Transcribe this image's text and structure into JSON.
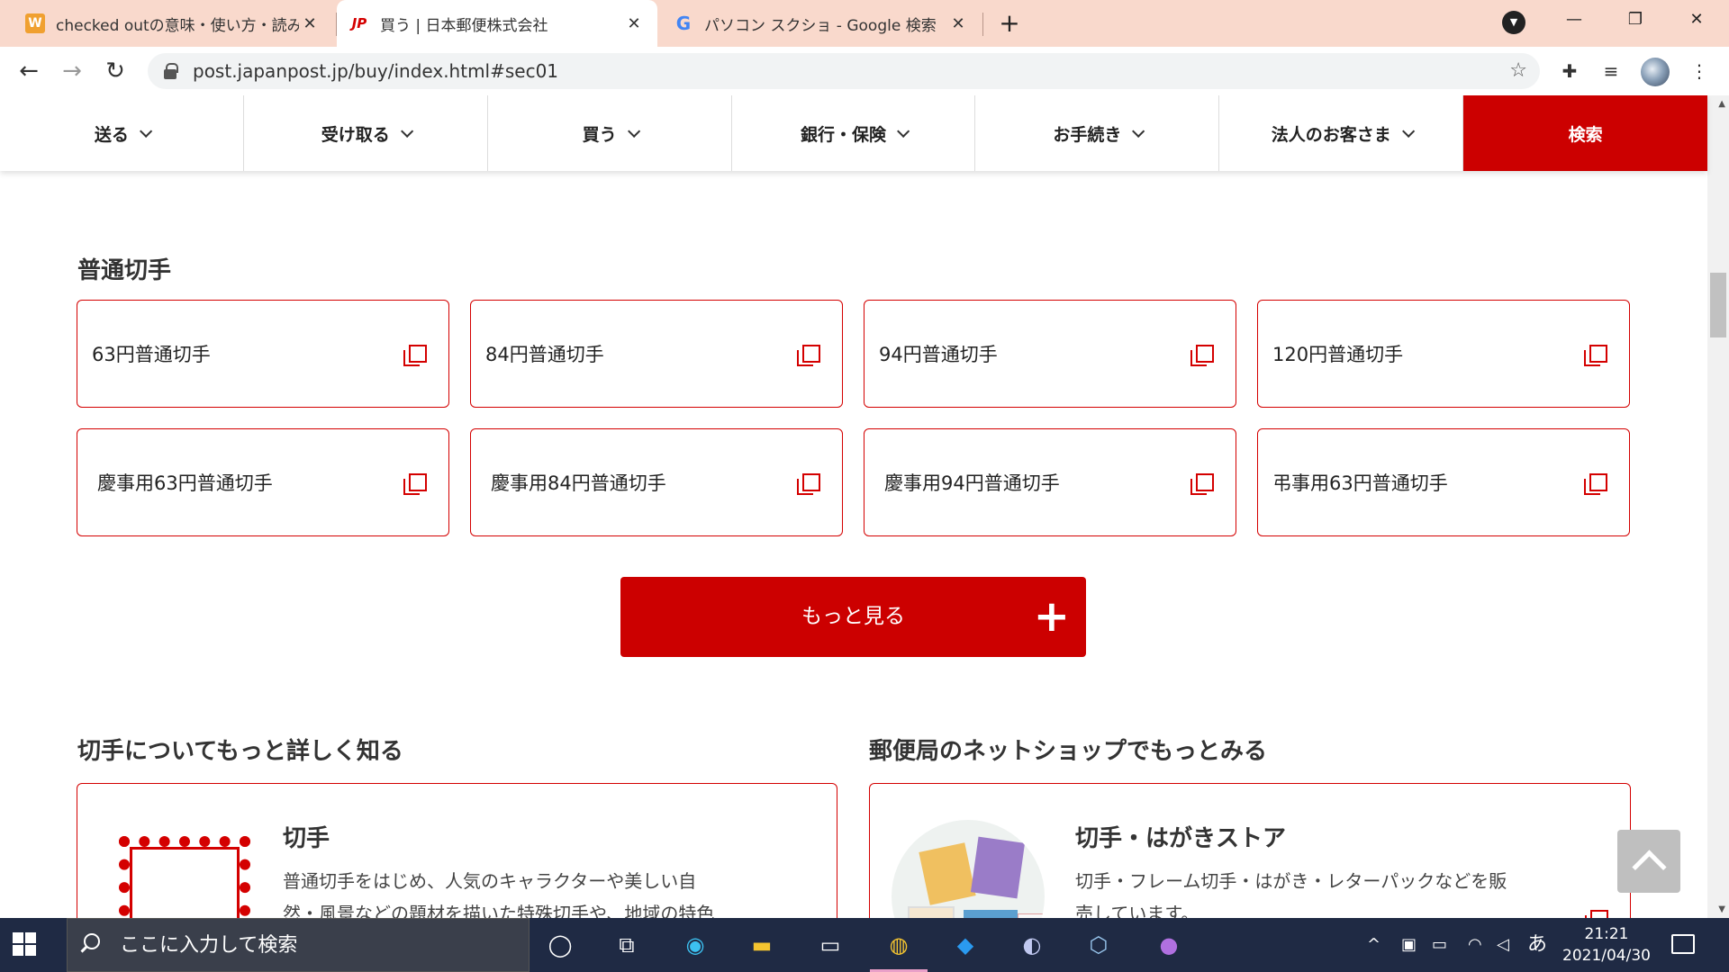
{
  "browser": {
    "tabs": [
      {
        "title": "checked outの意味・使い方・読み方",
        "favicon": "W"
      },
      {
        "title": "買う | 日本郵便株式会社",
        "favicon": "JP"
      },
      {
        "title": "パソコン スクショ - Google 検索",
        "favicon": "G"
      }
    ],
    "url": "post.japanpost.jp/buy/index.html#sec01"
  },
  "sitenav": {
    "items": [
      "送る",
      "受け取る",
      "買う",
      "銀行・保険",
      "お手続き",
      "法人のお客さま"
    ],
    "search_label": "検索"
  },
  "stamps": {
    "title": "普通切手",
    "items": [
      "63円普通切手",
      "84円普通切手",
      "94円普通切手",
      "120円普通切手",
      "慶事用63円普通切手",
      "慶事用84円普通切手",
      "慶事用94円普通切手",
      "弔事用63円普通切手"
    ],
    "more_label": "もっと見る",
    "more_icon": "+"
  },
  "learn": {
    "title": "切手についてもっと詳しく知る",
    "card_title": "切手",
    "card_desc_1": "普通切手をはじめ、人気のキャラクターや美しい自",
    "card_desc_2": "然・風景などの題材を描いた特殊切手や、地域の特色"
  },
  "shop": {
    "title": "郵便局のネットショップでもっとみる",
    "card_title": "切手・はがきストア",
    "card_desc_1": "切手・フレーム切手・はがき・レターパックなどを販",
    "card_desc_2": "売しています。"
  },
  "taskbar": {
    "search_placeholder": "ここに入力して検索",
    "ime": "あ",
    "time": "21:21",
    "date": "2021/04/30"
  }
}
